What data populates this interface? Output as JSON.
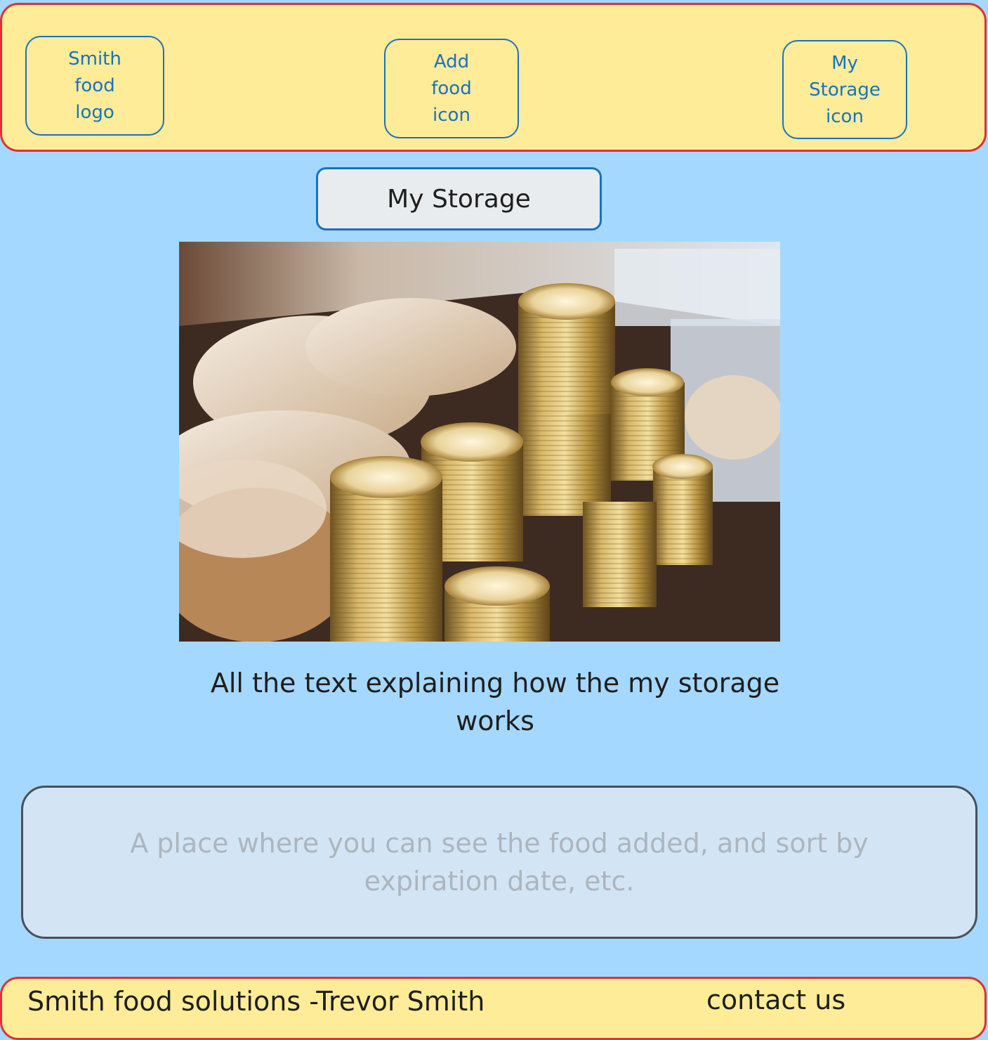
{
  "header": {
    "logo_label": "Smith\nfood\nlogo",
    "add_food_label": "Add\nfood\nicon",
    "my_storage_label": "My\nStorage\nicon"
  },
  "page": {
    "title": "My Storage",
    "explanation": "All the text explaining how the my storage works"
  },
  "storage_list": {
    "placeholder": "A place where you can see the food added, and sort by expiration date, etc."
  },
  "footer": {
    "name": "Smith food solutions -Trevor Smith",
    "contact": "contact us"
  },
  "colors": {
    "page_background": "#a5d8ff",
    "bar_fill": "#ffec99",
    "bar_border": "#e03131",
    "nav_stroke": "#1971c2",
    "placeholder_text": "#adb5bd"
  }
}
